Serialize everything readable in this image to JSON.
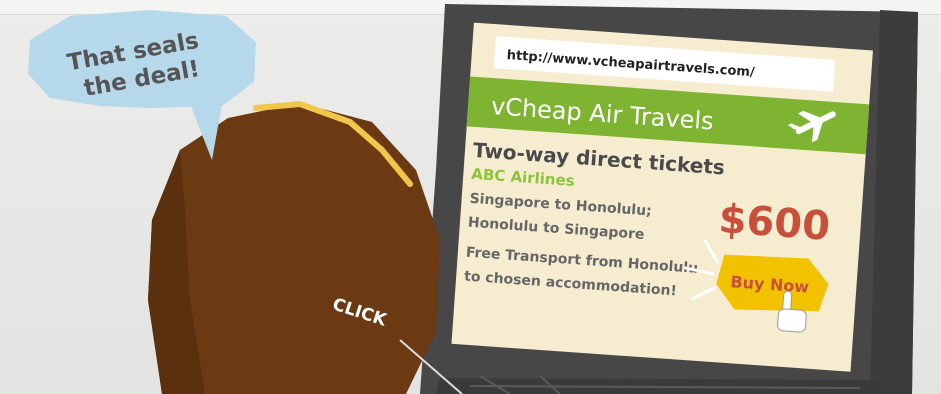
{
  "speech_bubble": {
    "line1": "That seals",
    "line2": "the deal!"
  },
  "click_label": "CLICK",
  "browser": {
    "url": "http://www.vcheapairtravels.com/"
  },
  "ad": {
    "site_name": "vCheap Air Travels",
    "headline": "Two-way direct tickets",
    "airline": "ABC Airlines",
    "route1": "Singapore to Honolulu;",
    "route2": "Honolulu to Singapore",
    "price": "$600",
    "extra1": "Free Transport from Honolulu",
    "extra2": "to chosen accommodation!",
    "buy_button": "Buy Now"
  },
  "colors": {
    "background": "#e6e6e4",
    "laptop_frame": "#4a4a4a",
    "screen": "#f6ecd0",
    "banner_green": "#7fb432",
    "airline_green": "#8cc43c",
    "price_red": "#c8503a",
    "button_yellow": "#f2c200",
    "head_brown": "#6b3a12",
    "bubble_blue": "#b5d9ea"
  }
}
